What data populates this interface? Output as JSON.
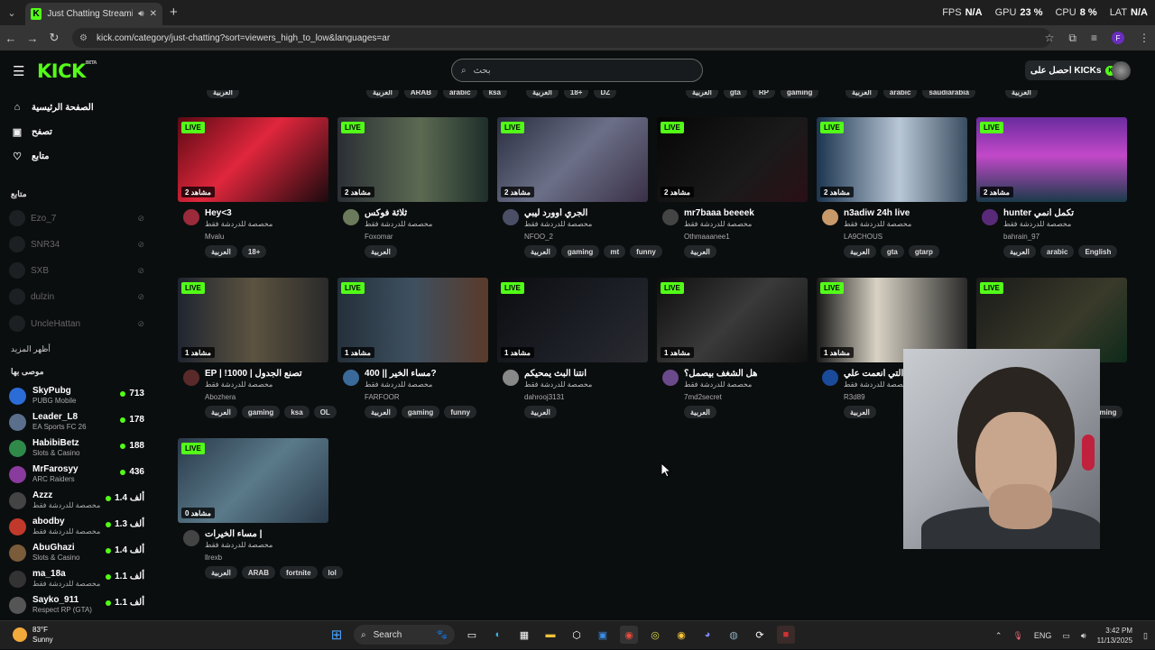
{
  "browser": {
    "tab_title": "Just Chatting Streaming - Ki",
    "url": "kick.com/category/just-chatting?sort=viewers_high_to_low&languages=ar",
    "perf": [
      {
        "label": "FPS",
        "value": "N/A"
      },
      {
        "label": "GPU",
        "value": "23 %"
      },
      {
        "label": "CPU",
        "value": "8 %"
      },
      {
        "label": "LAT",
        "value": "N/A"
      }
    ]
  },
  "header": {
    "logo": "KICK",
    "logo_badge": "BETA",
    "search_placeholder": "بحث",
    "kicks_label": "احصل على KICKs"
  },
  "sidebar": {
    "nav": [
      {
        "label": "الصفحة الرئيسية",
        "icon": "home-icon"
      },
      {
        "label": "تصفح",
        "icon": "browse-icon"
      },
      {
        "label": "متابع",
        "icon": "heart-icon"
      }
    ],
    "following_title": "متابع",
    "following": [
      "Ezo_7",
      "SNR34",
      "SXB",
      "dulzin",
      "UncleHattan"
    ],
    "show_more": "أظهر المزيد",
    "recommended_title": "موصى بها",
    "recommended": [
      {
        "name": "SkyPubg",
        "category": "PUBG Mobile",
        "viewers": "713",
        "color": "#2b6cd6"
      },
      {
        "name": "Leader_L8",
        "category": "EA Sports FC 26",
        "viewers": "178",
        "color": "#5a6f8c"
      },
      {
        "name": "HabibiBetz",
        "category": "Slots & Casino",
        "viewers": "188",
        "color": "#2f8a4a"
      },
      {
        "name": "MrFarosyy",
        "category": "ARC Raiders",
        "viewers": "436",
        "color": "#8a3b9e"
      },
      {
        "name": "Azzz",
        "category": "مخصصة للدردشة فقط",
        "viewers": "1.4 ألف",
        "color": "#444"
      },
      {
        "name": "abodby",
        "category": "مخصصة للدردشة فقط",
        "viewers": "1.3 ألف",
        "color": "#c0392b"
      },
      {
        "name": "AbuGhazi",
        "category": "Slots & Casino",
        "viewers": "1.4 ألف",
        "color": "#7a5b3a"
      },
      {
        "name": "ma_18a",
        "category": "مخصصة للدردشة فقط",
        "viewers": "1.1 ألف",
        "color": "#333"
      },
      {
        "name": "Sayko_911",
        "category": "Respect RP (GTA)",
        "viewers": "1.1 ألف",
        "color": "#555"
      }
    ]
  },
  "top_tags": [
    {
      "tags": [
        "العربية"
      ]
    },
    {
      "tags": [
        "العربية",
        "ARAB",
        "arabic",
        "ksa"
      ]
    },
    {
      "tags": [
        "العربية",
        "18+",
        "DZ"
      ]
    },
    {
      "tags": [
        "العربية",
        "gta",
        "RP",
        "gaming"
      ]
    },
    {
      "tags": [
        "العربية",
        "arabic",
        "saudiarabia"
      ]
    },
    {
      "tags": [
        "العربية"
      ]
    }
  ],
  "streams": [
    {
      "title": "Hey<3",
      "user": "Mvalu",
      "viewers": "2 مشاهد",
      "tags": [
        "العربية",
        "18+"
      ],
      "thumb": "linear-gradient(135deg,#5a0a14,#e0263c 45%,#1b0a0e)",
      "av": "#9b2a3a"
    },
    {
      "title": "ثلاثة فوكس",
      "user": "Foxomar",
      "viewers": "2 مشاهد",
      "tags": [
        "العربية"
      ],
      "thumb": "linear-gradient(90deg,#2b2f35,#5c6a52 55%,#1e2f2a)",
      "av": "#6a7a5a"
    },
    {
      "title": "الجري أوورد ليبي",
      "user": "NFOO_2",
      "viewers": "2 مشاهد",
      "tags": [
        "العربية",
        "gaming",
        "mt",
        "funny"
      ],
      "thumb": "linear-gradient(135deg,#2a2d3e,#6b7088 50%,#3a3046)",
      "av": "#4a4f66"
    },
    {
      "title": "mr7baaa beeeek",
      "user": "Othmaaanee1",
      "viewers": "2 مشاهد",
      "tags": [
        "العربية"
      ],
      "thumb": "linear-gradient(135deg,#060606,#1a1a1a 60%,#2a0f16)",
      "av": "#444"
    },
    {
      "title": "n3adiw 24h live",
      "user": "LA9CHOUS",
      "viewers": "2 مشاهد",
      "tags": [
        "العربية",
        "gta",
        "gtarp"
      ],
      "thumb": "linear-gradient(90deg,#1c3550,#b9c7d6 55%,#3a4d60)",
      "av": "#c89a6a"
    },
    {
      "title": "hunter تكمل انمي",
      "user": "bahrain_97",
      "viewers": "2 مشاهد",
      "tags": [
        "العربية",
        "arabic",
        "English"
      ],
      "thumb": "linear-gradient(180deg,#6a2b9e,#c248c9 45%,#1a3b4a)",
      "av": "#5a2a7a"
    },
    {
      "title": "EP | !1000 | تصنع الجدول",
      "user": "Abozhera",
      "viewers": "1 مشاهد",
      "tags": [
        "العربية",
        "gaming",
        "ksa",
        "OL"
      ],
      "thumb": "linear-gradient(90deg,#1f2530,#5c5340 50%,#2a2a2a)",
      "av": "#5a2a2a"
    },
    {
      "title": "مساء الخير || 400?",
      "user": "FARFOOR",
      "viewers": "1 مشاهد",
      "tags": [
        "العربية",
        "gaming",
        "funny"
      ],
      "thumb": "linear-gradient(90deg,#24303a,#3e5060 50%,#5a3a2a)",
      "av": "#3a6a9a"
    },
    {
      "title": "انتنا البث يمحيكم",
      "user": "dahrooj3131",
      "viewers": "1 مشاهد",
      "tags": [
        "العربية"
      ],
      "thumb": "linear-gradient(135deg,#0c0d10,#1c1f26 60%,#2a2a30)",
      "av": "#888"
    },
    {
      "title": "هل الشغف بيصمل؟",
      "user": "7md2secret",
      "viewers": "1 مشاهد",
      "tags": [
        "العربية"
      ],
      "thumb": "linear-gradient(135deg,#0e0e0e,#3a3a3a 50%,#101010)",
      "av": "#6a4a8a"
    },
    {
      "title": "ملك التي أنعمت علي",
      "user": "R3d89",
      "viewers": "1 مشاهد",
      "tags": [
        "العربية"
      ],
      "thumb": "linear-gradient(90deg,#1a1a1a,#d8d2c4 40%,#2a2a2a)",
      "av": "#1a4a9a"
    },
    {
      "title": "",
      "user": "",
      "viewers": "",
      "tags": [
        "gaming"
      ],
      "thumb": "linear-gradient(135deg,#1a1a1a,#3a3a2a 60%,#0e2a1a)",
      "av": "#333"
    },
    {
      "title": "مساء الخيرات |",
      "user": "llrexb",
      "viewers": "0 مشاهد",
      "tags": [
        "العربية",
        "ARAB",
        "fortnite",
        "lol"
      ],
      "thumb": "linear-gradient(135deg,#2a3a4a,#5a7a8a 50%,#2a3a4a)",
      "av": "#444"
    }
  ],
  "card_category": "مخصصة للدردشة فقط",
  "live_label": "LIVE",
  "taskbar": {
    "temp": "83°F",
    "condition": "Sunny",
    "search": "Search",
    "lang": "ENG",
    "time": "3:42 PM",
    "date": "11/13/2025"
  }
}
